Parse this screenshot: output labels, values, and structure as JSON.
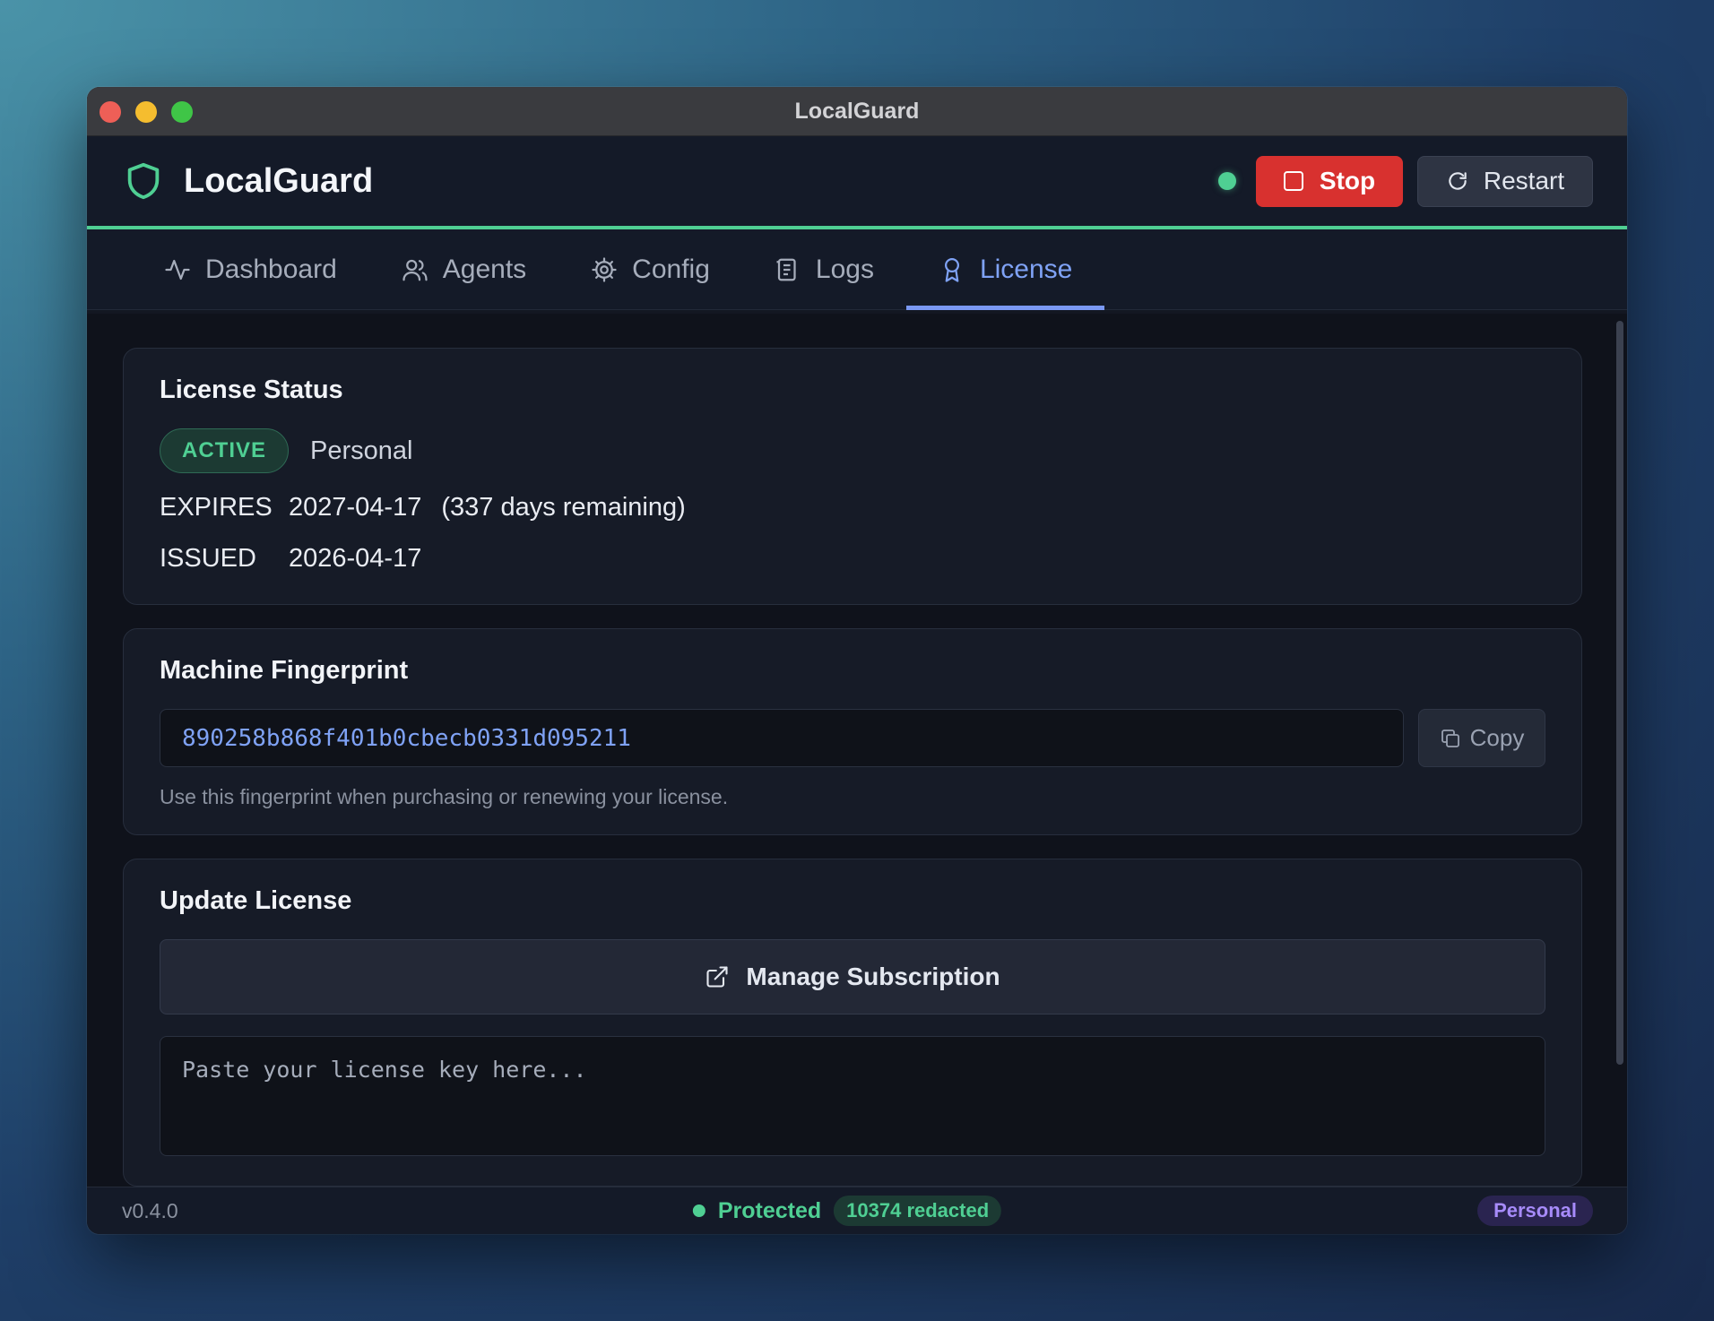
{
  "window": {
    "title": "LocalGuard"
  },
  "header": {
    "app_name": "LocalGuard",
    "status_color": "#4fcf93",
    "stop_label": "Stop",
    "restart_label": "Restart"
  },
  "tabs": [
    {
      "label": "Dashboard",
      "icon": "activity-icon"
    },
    {
      "label": "Agents",
      "icon": "users-icon"
    },
    {
      "label": "Config",
      "icon": "gear-icon"
    },
    {
      "label": "Logs",
      "icon": "scroll-icon"
    },
    {
      "label": "License",
      "icon": "award-icon",
      "active": true
    }
  ],
  "license_status": {
    "title": "License Status",
    "badge": "ACTIVE",
    "plan": "Personal",
    "expires_label": "EXPIRES",
    "expires_date": "2027-04-17",
    "remaining": "(337 days remaining)",
    "issued_label": "ISSUED",
    "issued_date": "2026-04-17"
  },
  "fingerprint": {
    "title": "Machine Fingerprint",
    "value": "890258b868f401b0cbecb0331d095211",
    "copy_label": "Copy",
    "hint": "Use this fingerprint when purchasing or renewing your license."
  },
  "update": {
    "title": "Update License",
    "manage_label": "Manage Subscription",
    "key_placeholder": "Paste your license key here..."
  },
  "footer": {
    "version": "v0.4.0",
    "protected": "Protected",
    "redacted": "10374 redacted",
    "plan": "Personal"
  },
  "colors": {
    "accent_green": "#4fcf93",
    "accent_blue": "#7fa2f5",
    "stop_red": "#d8312f",
    "plan_purple": "#a78bfa"
  }
}
